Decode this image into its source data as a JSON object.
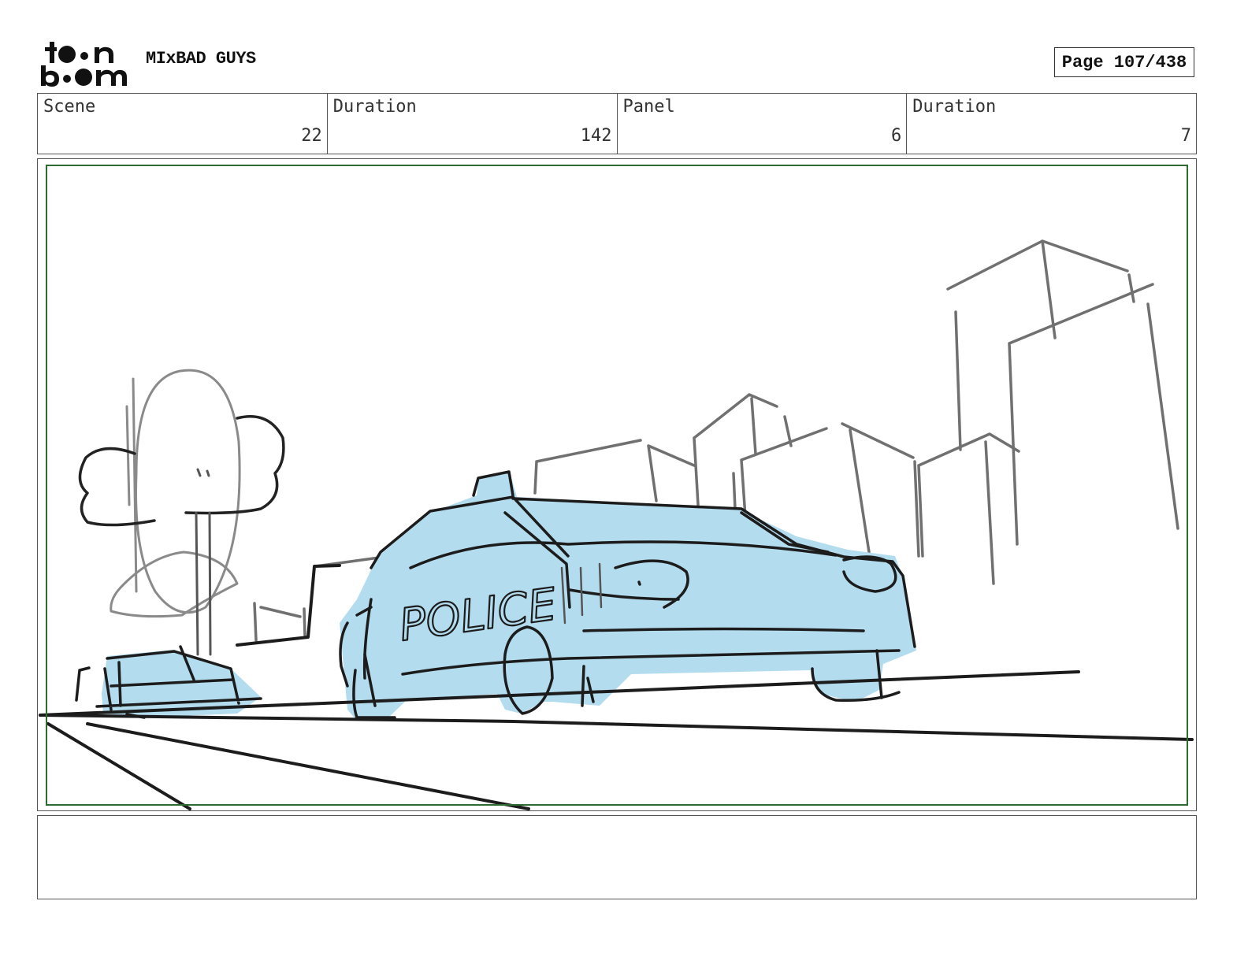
{
  "header": {
    "logo": "toon boom",
    "project_title": "MIxBAD GUYS",
    "page_label": "Page 107/438"
  },
  "info": {
    "scene_label": "Scene",
    "scene_value": "22",
    "scene_duration_label": "Duration",
    "scene_duration_value": "142",
    "panel_label": "Panel",
    "panel_value": "6",
    "panel_duration_label": "Duration",
    "panel_duration_value": "7"
  },
  "panel": {
    "car_lettering": "POLICE",
    "colors": {
      "fill": "#b4dcef",
      "ink": "#1c1c1c",
      "pencil": "#6e6e6e",
      "frame": "#2e6b2e"
    }
  },
  "notes": {
    "text": ""
  }
}
